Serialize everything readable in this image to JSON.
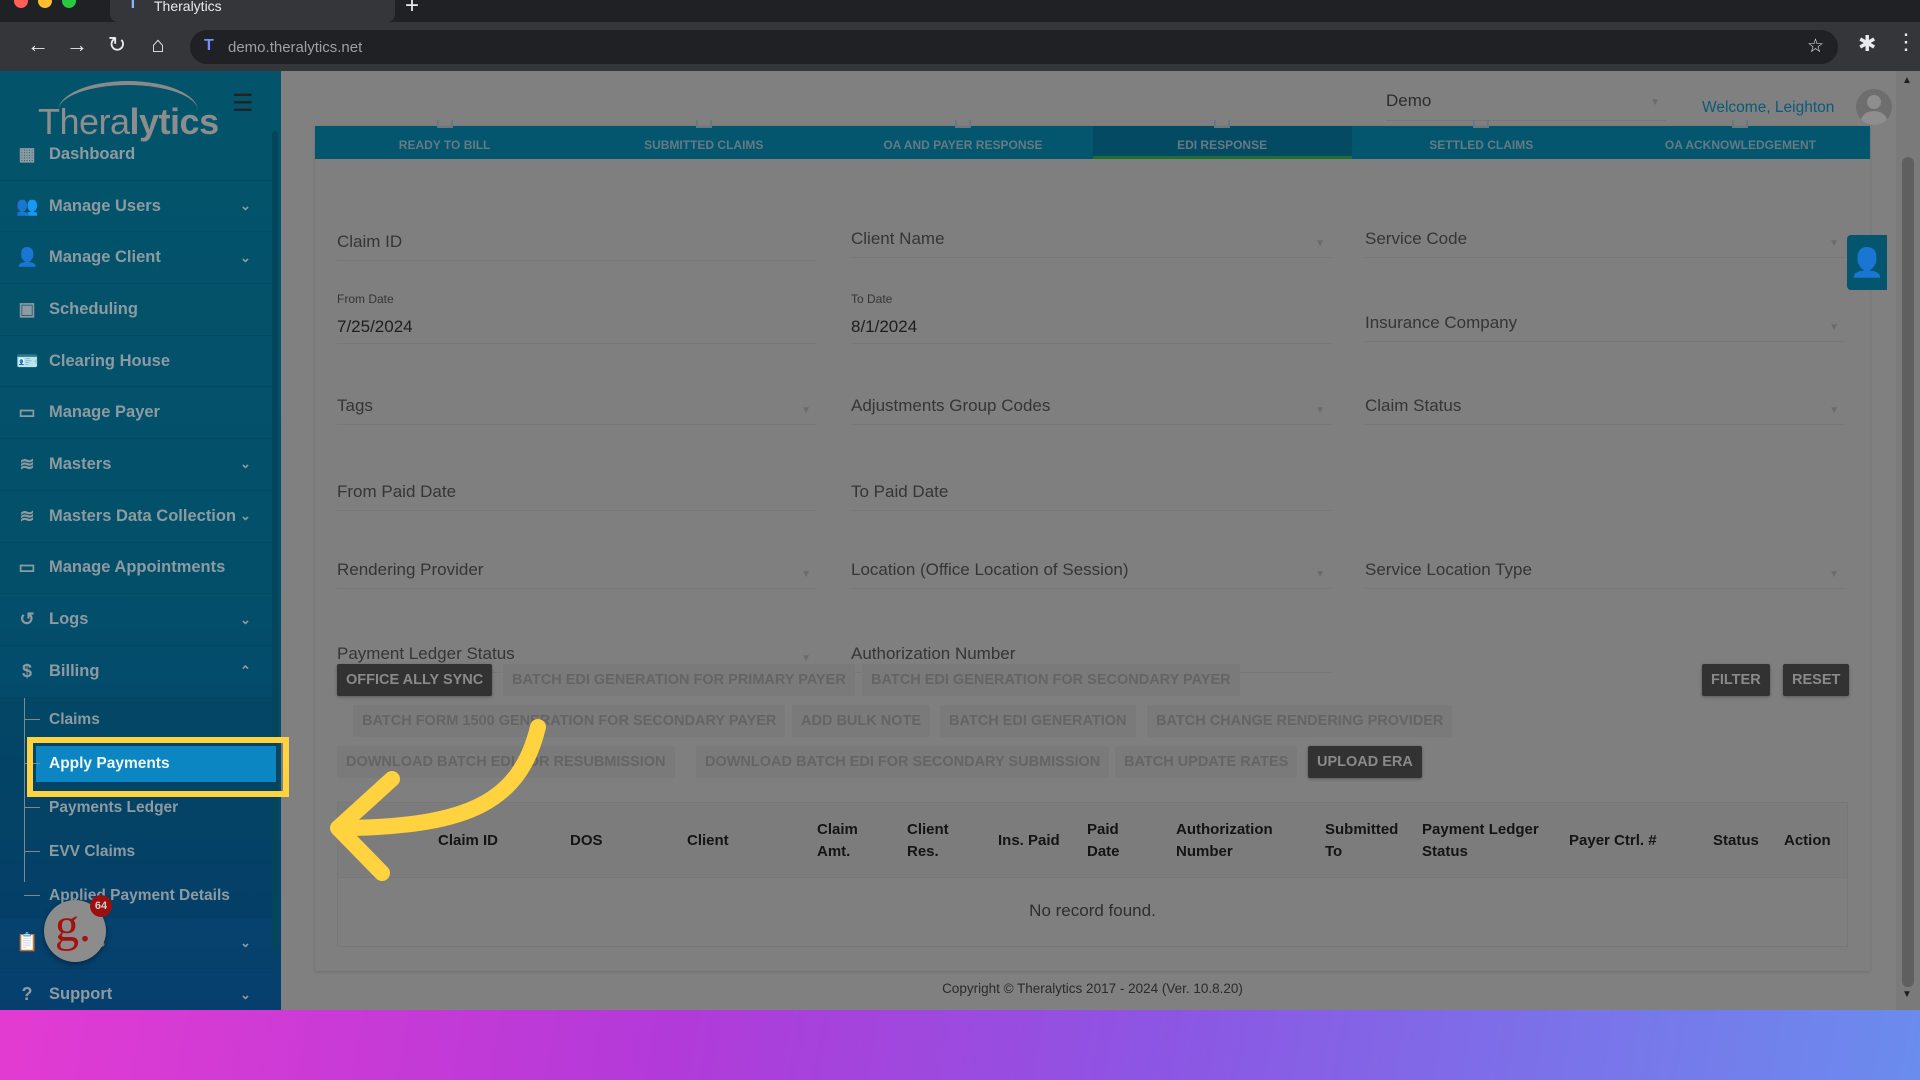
{
  "browser": {
    "tab_title": "Theralytics",
    "favicon_letter": "T",
    "new_tab": "+",
    "url": "demo.theralytics.net",
    "icons": {
      "back": "←",
      "forward": "→",
      "reload": "↻",
      "home": "⌂",
      "bookmark": "☆",
      "extensions": "✱",
      "menu": "⋮"
    }
  },
  "app": {
    "logo": {
      "light": "Thera",
      "bold": "lytics"
    },
    "collapse_icon": "☰",
    "header": {
      "company": "Demo",
      "welcome": "Welcome, Leighton"
    },
    "sidebar": {
      "items": [
        {
          "label": "Dashboard",
          "icon": "▦",
          "chevron": ""
        },
        {
          "label": "Manage Users",
          "icon": "👥",
          "chevron": "⌄"
        },
        {
          "label": "Manage Client",
          "icon": "👤",
          "chevron": "⌄"
        },
        {
          "label": "Scheduling",
          "icon": "▣",
          "chevron": ""
        },
        {
          "label": "Clearing House",
          "icon": "🪪",
          "chevron": ""
        },
        {
          "label": "Manage Payer",
          "icon": "▭",
          "chevron": ""
        },
        {
          "label": "Masters",
          "icon": "≋",
          "chevron": "⌄"
        },
        {
          "label": "Masters Data Collection",
          "icon": "≋",
          "chevron": "⌄"
        },
        {
          "label": "Manage Appointments",
          "icon": "▭",
          "chevron": ""
        },
        {
          "label": "Logs",
          "icon": "↺",
          "chevron": "⌄"
        },
        {
          "label": "Billing",
          "icon": "$",
          "chevron": "⌃"
        }
      ],
      "billing_sub": [
        {
          "label": "Claims",
          "active": false
        },
        {
          "label": "Apply Payments",
          "active": true
        },
        {
          "label": "Payments Ledger",
          "active": false
        },
        {
          "label": "EVV Claims",
          "active": false
        },
        {
          "label": "Applied Payment Details",
          "active": false
        }
      ],
      "after_items": [
        {
          "label": "s",
          "icon": "📋",
          "chevron": "⌄"
        },
        {
          "label": "Support",
          "icon": "?",
          "chevron": "⌄"
        }
      ]
    },
    "notification_badge": {
      "letter": "g.",
      "count": "64"
    },
    "tabs": [
      {
        "label": "READY TO BILL",
        "active": false
      },
      {
        "label": "SUBMITTED CLAIMS",
        "active": false
      },
      {
        "label": "OA AND PAYER RESPONSE",
        "active": false
      },
      {
        "label": "EDI RESPONSE",
        "active": true
      },
      {
        "label": "SETTLED CLAIMS",
        "active": false
      },
      {
        "label": "OA ACKNOWLEDGEMENT",
        "active": false
      }
    ],
    "filters": {
      "claim_id": {
        "label": "Claim ID"
      },
      "client_name": {
        "label": "Client Name"
      },
      "service_code": {
        "label": "Service Code"
      },
      "from_date": {
        "label": "From Date",
        "value": "7/25/2024"
      },
      "to_date": {
        "label": "To Date",
        "value": "8/1/2024"
      },
      "insurance_company": {
        "label": "Insurance Company"
      },
      "tags": {
        "label": "Tags"
      },
      "adjustments_group_codes": {
        "label": "Adjustments Group Codes"
      },
      "claim_status": {
        "label": "Claim Status"
      },
      "from_paid_date": {
        "label": "From Paid Date"
      },
      "to_paid_date": {
        "label": "To Paid Date"
      },
      "rendering_provider": {
        "label": "Rendering Provider"
      },
      "location": {
        "label": "Location (Office Location of Session)"
      },
      "service_location_type": {
        "label": "Service Location Type"
      },
      "payment_ledger_status": {
        "label": "Payment Ledger Status"
      },
      "authorization_number": {
        "label": "Authorization Number"
      },
      "dropdown_caret": "▼"
    },
    "actions": {
      "office_ally_sync": "OFFICE ALLY SYNC",
      "batch_edi_primary": "BATCH EDI GENERATION FOR PRIMARY PAYER",
      "batch_edi_secondary": "BATCH EDI GENERATION FOR SECONDARY PAYER",
      "filter": "FILTER",
      "reset": "RESET",
      "batch_form_1500_secondary": "BATCH FORM 1500 GENERATION FOR SECONDARY PAYER",
      "add_bulk_note": "ADD BULK NOTE",
      "batch_edi_generation": "BATCH EDI GENERATION",
      "batch_change_rendering_provider": "BATCH CHANGE RENDERING PROVIDER",
      "download_batch_edi_resubmission": "DOWNLOAD BATCH EDI FOR RESUBMISSION",
      "download_batch_edi_secondary_submission": "DOWNLOAD BATCH EDI FOR SECONDARY SUBMISSION",
      "batch_update_rates": "BATCH UPDATE RATES",
      "upload_era": "UPLOAD ERA"
    },
    "table": {
      "columns": [
        "Claim ID",
        "DOS",
        "Client",
        "Claim\nAmt.",
        "Client\nRes.",
        "Ins. Paid",
        "Paid\nDate",
        "Authorization\nNumber",
        "Submitted\nTo",
        "Payment Ledger\nStatus",
        "Payer Ctrl. #",
        "Status",
        "Action"
      ],
      "empty_message": "No record found."
    },
    "footer": "Copyright © Theralytics 2017 - 2024 (Ver. 10.8.20)",
    "user_fab_icon": "👤",
    "scroll": {
      "up": "▲",
      "down": "▼"
    }
  },
  "colors": {
    "brand_teal": "#03566e",
    "active_item": "#0b86c3",
    "highlight": "#ffd23f",
    "active_tab_underline": "#1f6f31",
    "welcome_text": "#0b5a78"
  }
}
